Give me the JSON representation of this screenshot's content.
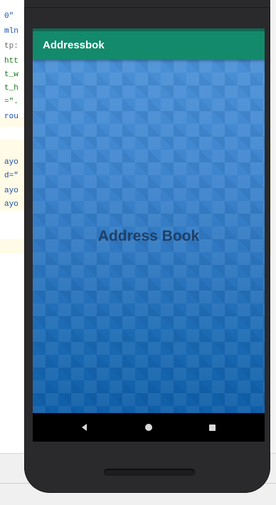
{
  "editor": {
    "code_lines": [
      {
        "text": "0\"",
        "style": "blue"
      },
      {
        "text": "mln",
        "style": "blue"
      },
      {
        "text": "tp:",
        "style": "gray"
      },
      {
        "text": "htt",
        "style": "green"
      },
      {
        "text": "t_w",
        "style": "green"
      },
      {
        "text": "t_h",
        "style": "green"
      },
      {
        "text": "=\".",
        "style": "green"
      },
      {
        "text": "rou",
        "style": "blue"
      },
      {
        "text": "ayo",
        "style": "blue"
      },
      {
        "text": "d=\"",
        "style": "blue"
      },
      {
        "text": "ayo",
        "style": "blue"
      },
      {
        "text": "ayo",
        "style": "blue"
      }
    ]
  },
  "app": {
    "title": "Addressbok",
    "main_text": "Address Book",
    "colors": {
      "app_bar": "#138a6b",
      "background_top": "#4a90d6",
      "background_bottom": "#0f5ea8",
      "text": "#1f3f66"
    }
  },
  "navigation": {
    "back_icon": "back-triangle-icon",
    "home_icon": "home-circle-icon",
    "recents_icon": "recents-square-icon"
  }
}
